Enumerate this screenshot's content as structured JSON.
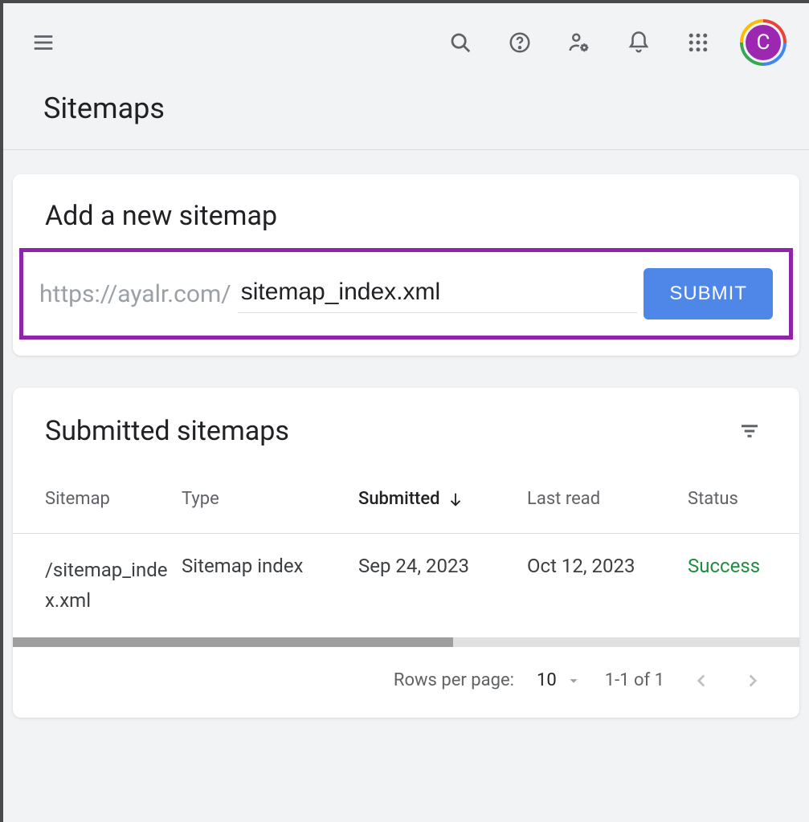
{
  "header": {
    "avatar_letter": "C"
  },
  "page": {
    "title": "Sitemaps"
  },
  "add_sitemap": {
    "title": "Add a new sitemap",
    "url_prefix": "https://ayalr.com/",
    "input_value": "sitemap_index.xml",
    "submit_label": "SUBMIT"
  },
  "submitted": {
    "title": "Submitted sitemaps",
    "columns": {
      "sitemap": "Sitemap",
      "type": "Type",
      "submitted": "Submitted",
      "last_read": "Last read",
      "status": "Status"
    },
    "rows": [
      {
        "sitemap": "/sitemap_index.xml",
        "type": "Sitemap index",
        "submitted": "Sep 24, 2023",
        "last_read": "Oct 12, 2023",
        "status": "Success"
      }
    ],
    "pagination": {
      "rows_label": "Rows per page:",
      "rows_value": "10",
      "range": "1-1 of 1"
    }
  }
}
